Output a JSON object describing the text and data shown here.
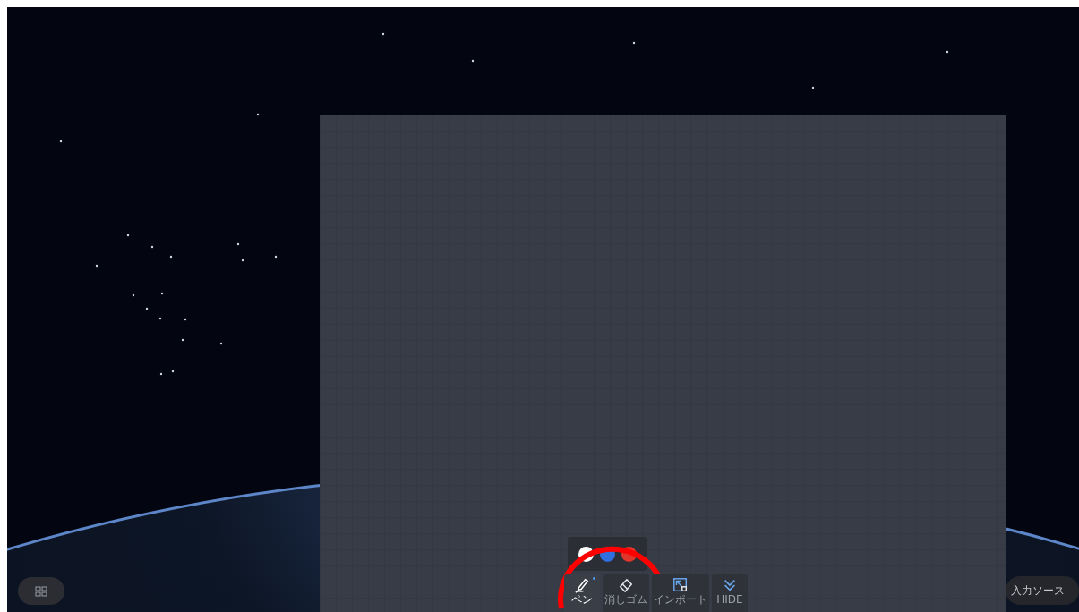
{
  "pen_colors": [
    {
      "color": "#ffffff"
    },
    {
      "color": "#2f6fe0"
    },
    {
      "color": "#e0362b"
    }
  ],
  "tools": [
    {
      "kind": "pen",
      "label": "ペン",
      "selected": true
    },
    {
      "kind": "eraser",
      "label": "消しゴム",
      "selected": false
    },
    {
      "kind": "import",
      "label": "インポート",
      "selected": false
    },
    {
      "kind": "hide",
      "label": "HIDE",
      "selected": false
    }
  ],
  "input_source_button": {
    "label": "入力ソース"
  }
}
